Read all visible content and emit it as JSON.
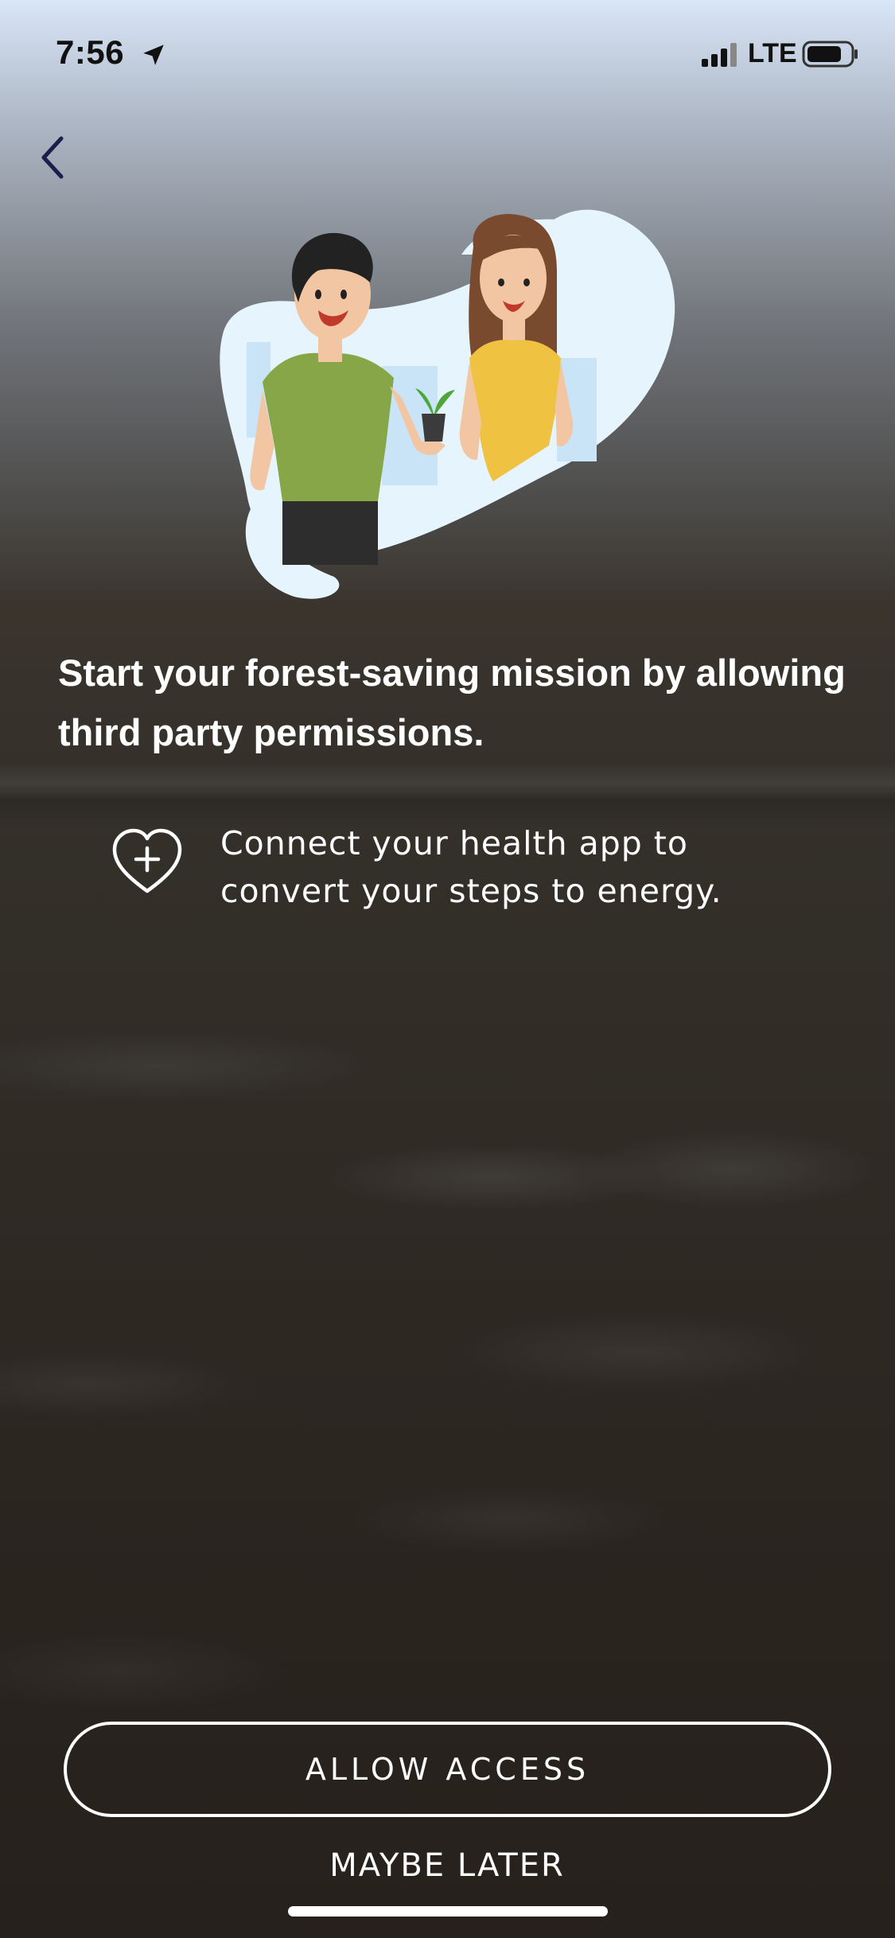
{
  "status_bar": {
    "time": "7:56",
    "network": "LTE",
    "icons": [
      "location-arrow-icon",
      "signal-icon",
      "battery-icon"
    ]
  },
  "nav": {
    "back_icon": "chevron-left-icon"
  },
  "illustration": {
    "icon": "people-holding-plant-illustration"
  },
  "content": {
    "headline": "Start your forest-saving mission by allowing third party permissions.",
    "permission": {
      "icon": "heart-plus-icon",
      "text": "Connect your health app to convert your steps to energy."
    }
  },
  "actions": {
    "allow_label": "ALLOW ACCESS",
    "later_label": "MAYBE LATER"
  },
  "colors": {
    "text": "#ffffff",
    "status_text": "#111111",
    "back_icon": "#1c1f4a",
    "blob": "#e6f4fe"
  }
}
